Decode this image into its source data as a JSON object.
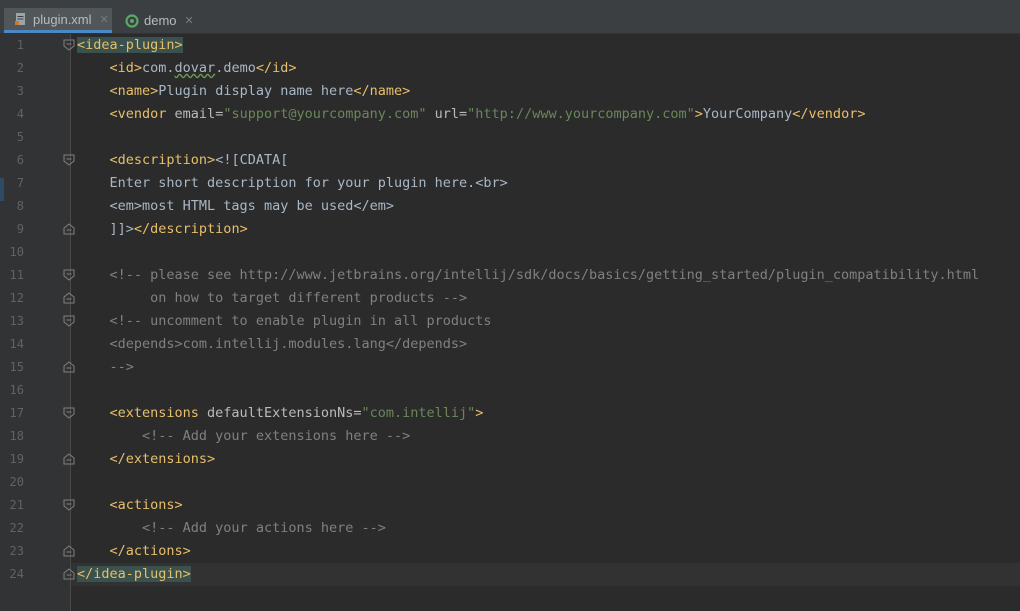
{
  "tabs": [
    {
      "label": "plugin.xml",
      "icon": "xml-file-icon",
      "active": true
    },
    {
      "label": "demo",
      "icon": "run-config-icon",
      "active": false
    }
  ],
  "gutter": {
    "line_numbers": [
      "1",
      "2",
      "3",
      "4",
      "5",
      "6",
      "7",
      "8",
      "9",
      "10",
      "11",
      "12",
      "13",
      "14",
      "15",
      "16",
      "17",
      "18",
      "19",
      "20",
      "21",
      "22",
      "23",
      "24"
    ]
  },
  "code": {
    "l1_tag": "<idea-plugin>",
    "l2_open": "<id>",
    "l2_text_a": "com.",
    "l2_text_typo": "dovar",
    "l2_text_b": ".demo",
    "l2_close": "</id>",
    "l3_open": "<name>",
    "l3_text": "Plugin display name here",
    "l3_close": "</name>",
    "l4_open": "<vendor",
    "l4_attr1": " email=",
    "l4_val1": "\"support@yourcompany.com\"",
    "l4_attr2": " url=",
    "l4_val2": "\"http://www.yourcompany.com\"",
    "l4_gt": ">",
    "l4_text": "YourCompany",
    "l4_close": "</vendor>",
    "l6_open": "<description>",
    "l6_cdata": "<![CDATA[",
    "l7_text": "Enter short description for your plugin here.<br>",
    "l8_text": "<em>most HTML tags may be used</em>",
    "l9_cdata": "]]>",
    "l9_close": "</description>",
    "l11_comment": "<!-- please see http://www.jetbrains.org/intellij/sdk/docs/basics/getting_started/plugin_compatibility.html",
    "l12_comment": "     on how to target different products -->",
    "l13_comment": "<!-- uncomment to enable plugin in all products",
    "l14_comment": "<depends>com.intellij.modules.lang</depends>",
    "l15_comment": "-->",
    "l17_open": "<extensions",
    "l17_attr": " defaultExtensionNs=",
    "l17_val": "\"com.intellij\"",
    "l17_gt": ">",
    "l18_comment": "<!-- Add your extensions here -->",
    "l19_close": "</extensions>",
    "l21_open": "<actions>",
    "l22_comment": "<!-- Add your actions here -->",
    "l23_close": "</actions>",
    "l24_tag": "</idea-plugin>"
  }
}
